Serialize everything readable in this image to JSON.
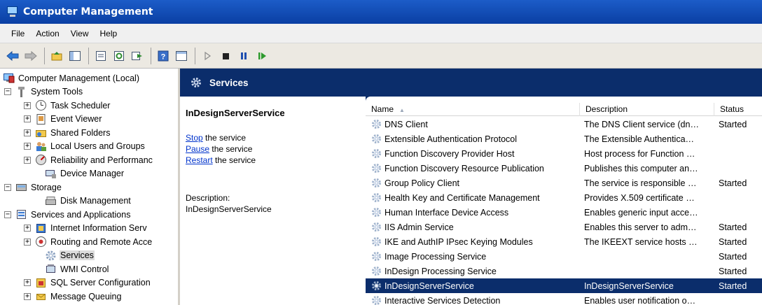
{
  "window": {
    "title": "Computer Management"
  },
  "menu": [
    "File",
    "Action",
    "View",
    "Help"
  ],
  "toolbar": {
    "icons": [
      "back-arrow-icon",
      "forward-arrow-icon",
      "up-folder-icon",
      "show-hide-tree-icon",
      "properties-icon",
      "refresh-icon",
      "export-list-icon",
      "help-icon",
      "show-hide-action-pane-icon",
      "start-service-icon",
      "stop-service-icon",
      "pause-service-icon",
      "resume-service-icon"
    ]
  },
  "tree": [
    {
      "label": "Computer Management (Local)",
      "level": 0,
      "expander": "",
      "icon": "computer-icon"
    },
    {
      "label": "System Tools",
      "level": 1,
      "expander": "−",
      "icon": "tools-icon"
    },
    {
      "label": "Task Scheduler",
      "level": 2,
      "expander": "+",
      "icon": "clock-icon"
    },
    {
      "label": "Event Viewer",
      "level": 2,
      "expander": "+",
      "icon": "event-viewer-icon"
    },
    {
      "label": "Shared Folders",
      "level": 2,
      "expander": "+",
      "icon": "shared-folder-icon"
    },
    {
      "label": "Local Users and Groups",
      "level": 2,
      "expander": "+",
      "icon": "users-icon"
    },
    {
      "label": "Reliability and Performanc",
      "level": 2,
      "expander": "+",
      "icon": "performance-icon"
    },
    {
      "label": "Device Manager",
      "level": 2,
      "expander": "",
      "icon": "device-manager-icon"
    },
    {
      "label": "Storage",
      "level": 1,
      "expander": "−",
      "icon": "storage-icon"
    },
    {
      "label": "Disk Management",
      "level": 2,
      "expander": "",
      "icon": "disk-icon"
    },
    {
      "label": "Services and Applications",
      "level": 1,
      "expander": "−",
      "icon": "services-apps-icon"
    },
    {
      "label": "Internet Information Serv",
      "level": 2,
      "expander": "+",
      "icon": "iis-icon"
    },
    {
      "label": "Routing and Remote Acce",
      "level": 2,
      "expander": "+",
      "icon": "routing-icon"
    },
    {
      "label": "Services",
      "level": 2,
      "expander": "",
      "icon": "gear-icon",
      "selected": true
    },
    {
      "label": "WMI Control",
      "level": 2,
      "expander": "",
      "icon": "wmi-icon"
    },
    {
      "label": "SQL Server Configuration",
      "level": 2,
      "expander": "+",
      "icon": "sql-server-icon"
    },
    {
      "label": "Message Queuing",
      "level": 2,
      "expander": "+",
      "icon": "message-queue-icon"
    }
  ],
  "panel": {
    "title": "Services",
    "extended": {
      "service_name": "InDesignServerService",
      "actions": [
        {
          "link": "Stop",
          "rest": " the service"
        },
        {
          "link": "Pause",
          "rest": " the service"
        },
        {
          "link": "Restart",
          "rest": " the service"
        }
      ],
      "description_label": "Description:",
      "description": "InDesignServerService"
    },
    "columns": [
      "Name",
      "Description",
      "Status"
    ],
    "sort_indicator": "▲",
    "rows": [
      {
        "name": "DNS Client",
        "description": "The DNS Client service (dn…",
        "status": "Started"
      },
      {
        "name": "Extensible Authentication Protocol",
        "description": "The Extensible Authentica…",
        "status": ""
      },
      {
        "name": "Function Discovery Provider Host",
        "description": "Host process for Function …",
        "status": ""
      },
      {
        "name": "Function Discovery Resource Publication",
        "description": "Publishes this computer an…",
        "status": ""
      },
      {
        "name": "Group Policy Client",
        "description": "The service is responsible …",
        "status": "Started"
      },
      {
        "name": "Health Key and Certificate Management",
        "description": "Provides X.509 certificate …",
        "status": ""
      },
      {
        "name": "Human Interface Device Access",
        "description": "Enables generic input acce…",
        "status": ""
      },
      {
        "name": "IIS Admin Service",
        "description": "Enables this server to adm…",
        "status": "Started"
      },
      {
        "name": "IKE and AuthIP IPsec Keying Modules",
        "description": "The IKEEXT service hosts …",
        "status": "Started"
      },
      {
        "name": "Image Processing Service",
        "description": "",
        "status": "Started"
      },
      {
        "name": "InDesign Processing Service",
        "description": "",
        "status": "Started"
      },
      {
        "name": "InDesignServerService",
        "description": "InDesignServerService",
        "status": "Started",
        "selected": true
      },
      {
        "name": "Interactive Services Detection",
        "description": "Enables user notification o…",
        "status": ""
      }
    ]
  },
  "colors": {
    "header_blue": "#0b2d6b",
    "title_blue": "#0a3fa3",
    "link": "#0033cc"
  }
}
